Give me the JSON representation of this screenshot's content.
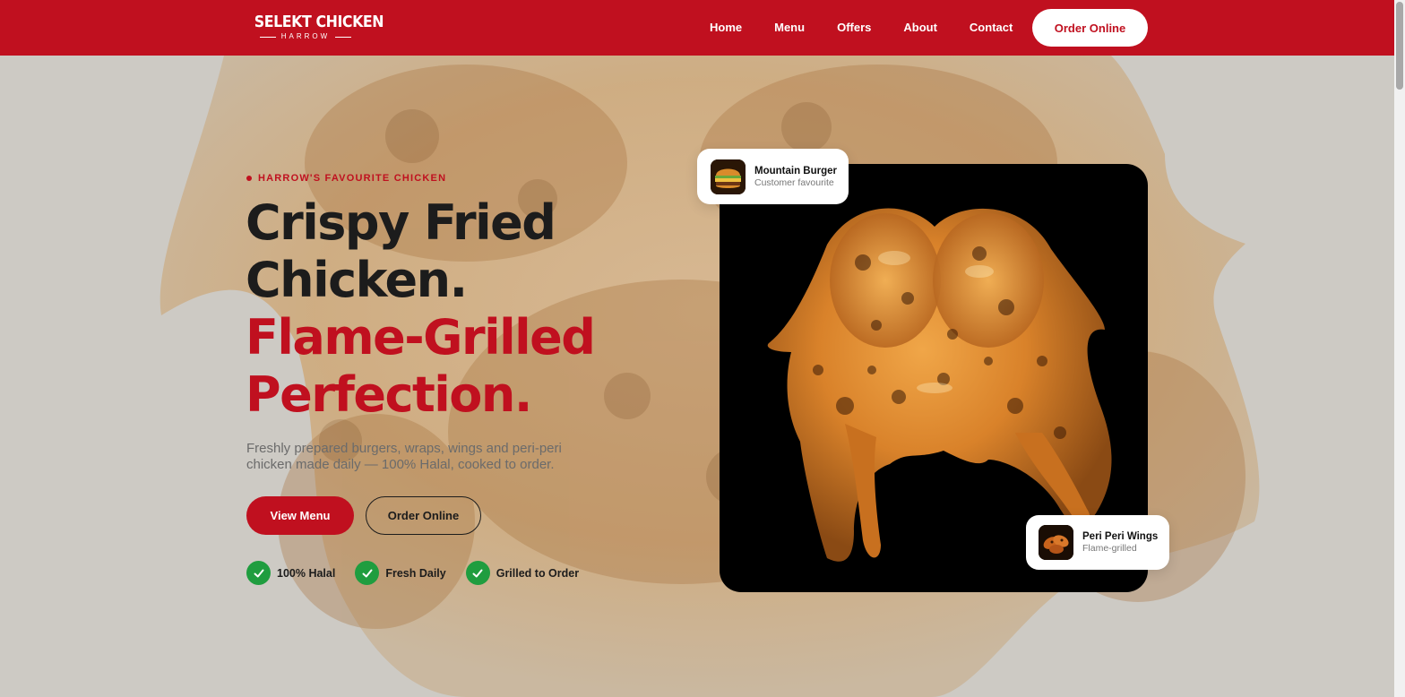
{
  "brand": {
    "name": "SELEKT CHICKEN",
    "location": "HARROW"
  },
  "nav": {
    "items": [
      "Home",
      "Menu",
      "Offers",
      "About",
      "Contact"
    ],
    "cta": "Order Online"
  },
  "hero": {
    "eyebrow": "HARROW'S FAVOURITE CHICKEN",
    "headline": {
      "line1": "Crispy Fried",
      "line2": "Chicken.",
      "line3": "Flame-Grilled",
      "line4": "Perfection."
    },
    "subcopy": "Freshly prepared burgers, wraps, wings and peri-peri chicken made daily — 100% Halal, cooked to order.",
    "primary_button": "View Menu",
    "secondary_button": "Order Online",
    "badges": [
      "100% Halal",
      "Fresh Daily",
      "Grilled to Order"
    ]
  },
  "cards": {
    "burger": {
      "title": "Mountain Burger",
      "subtitle": "Customer favourite"
    },
    "wings": {
      "title": "Peri Peri Wings",
      "subtitle": "Flame-grilled"
    }
  },
  "colors": {
    "brand_red": "#c0101f",
    "dark": "#1c1c1c",
    "check_green": "#1f9d3f"
  },
  "icons": {
    "badge": "check-icon"
  }
}
